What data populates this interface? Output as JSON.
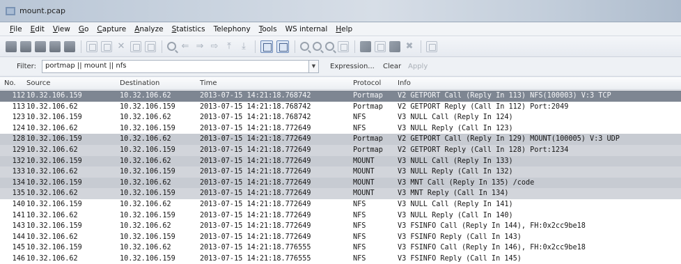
{
  "window": {
    "title": "mount.pcap"
  },
  "menu": [
    {
      "u": "F",
      "rest": "ile"
    },
    {
      "u": "E",
      "rest": "dit"
    },
    {
      "u": "V",
      "rest": "iew"
    },
    {
      "u": "G",
      "rest": "o"
    },
    {
      "u": "C",
      "rest": "apture"
    },
    {
      "u": "A",
      "rest": "nalyze"
    },
    {
      "u": "S",
      "rest": "tatistics"
    },
    {
      "u": "",
      "rest": "Telephony"
    },
    {
      "u": "T",
      "rest": "ools"
    },
    {
      "u": "",
      "rest": "WS internal"
    },
    {
      "u": "H",
      "rest": "elp"
    }
  ],
  "filter": {
    "label": "Filter:",
    "value": "portmap || mount || nfs",
    "expression": "Expression...",
    "clear": "Clear",
    "apply": "Apply"
  },
  "columns": {
    "no": "No.",
    "source": "Source",
    "destination": "Destination",
    "time": "Time",
    "protocol": "Protocol",
    "info": "Info"
  },
  "rows": [
    {
      "no": "112",
      "src": "10.32.106.159",
      "dst": "10.32.106.62",
      "time": "2013-07-15 14:21:18.768742",
      "proto": "Portmap",
      "info": "V2 GETPORT Call (Reply In 113) NFS(100003) V:3 TCP",
      "style": "sel"
    },
    {
      "no": "113",
      "src": "10.32.106.62",
      "dst": "10.32.106.159",
      "time": "2013-07-15 14:21:18.768742",
      "proto": "Portmap",
      "info": "V2 GETPORT Reply (Call In 112) Port:2049",
      "style": ""
    },
    {
      "no": "123",
      "src": "10.32.106.159",
      "dst": "10.32.106.62",
      "time": "2013-07-15 14:21:18.768742",
      "proto": "NFS",
      "info": "V3 NULL Call (Reply In 124)",
      "style": ""
    },
    {
      "no": "124",
      "src": "10.32.106.62",
      "dst": "10.32.106.159",
      "time": "2013-07-15 14:21:18.772649",
      "proto": "NFS",
      "info": "V3 NULL Reply (Call In 123)",
      "style": ""
    },
    {
      "no": "128",
      "src": "10.32.106.159",
      "dst": "10.32.106.62",
      "time": "2013-07-15 14:21:18.772649",
      "proto": "Portmap",
      "info": "V2 GETPORT Call (Reply In 129) MOUNT(100005) V:3 UDP",
      "style": "hl"
    },
    {
      "no": "129",
      "src": "10.32.106.62",
      "dst": "10.32.106.159",
      "time": "2013-07-15 14:21:18.772649",
      "proto": "Portmap",
      "info": "V2 GETPORT Reply (Call In 128) Port:1234",
      "style": "hl alt"
    },
    {
      "no": "132",
      "src": "10.32.106.159",
      "dst": "10.32.106.62",
      "time": "2013-07-15 14:21:18.772649",
      "proto": "MOUNT",
      "info": "V3 NULL Call (Reply In 133)",
      "style": "hl"
    },
    {
      "no": "133",
      "src": "10.32.106.62",
      "dst": "10.32.106.159",
      "time": "2013-07-15 14:21:18.772649",
      "proto": "MOUNT",
      "info": "V3 NULL Reply (Call In 132)",
      "style": "hl alt"
    },
    {
      "no": "134",
      "src": "10.32.106.159",
      "dst": "10.32.106.62",
      "time": "2013-07-15 14:21:18.772649",
      "proto": "MOUNT",
      "info": "V3 MNT Call (Reply In 135) /code",
      "style": "hl"
    },
    {
      "no": "135",
      "src": "10.32.106.62",
      "dst": "10.32.106.159",
      "time": "2013-07-15 14:21:18.772649",
      "proto": "MOUNT",
      "info": "V3 MNT Reply (Call In 134)",
      "style": "hl alt"
    },
    {
      "no": "140",
      "src": "10.32.106.159",
      "dst": "10.32.106.62",
      "time": "2013-07-15 14:21:18.772649",
      "proto": "NFS",
      "info": "V3 NULL Call (Reply In 141)",
      "style": ""
    },
    {
      "no": "141",
      "src": "10.32.106.62",
      "dst": "10.32.106.159",
      "time": "2013-07-15 14:21:18.772649",
      "proto": "NFS",
      "info": "V3 NULL Reply (Call In 140)",
      "style": ""
    },
    {
      "no": "143",
      "src": "10.32.106.159",
      "dst": "10.32.106.62",
      "time": "2013-07-15 14:21:18.772649",
      "proto": "NFS",
      "info": "V3 FSINFO Call (Reply In 144), FH:0x2cc9be18",
      "style": ""
    },
    {
      "no": "144",
      "src": "10.32.106.62",
      "dst": "10.32.106.159",
      "time": "2013-07-15 14:21:18.772649",
      "proto": "NFS",
      "info": "V3 FSINFO Reply (Call In 143)",
      "style": ""
    },
    {
      "no": "145",
      "src": "10.32.106.159",
      "dst": "10.32.106.62",
      "time": "2013-07-15 14:21:18.776555",
      "proto": "NFS",
      "info": "V3 FSINFO Call (Reply In 146), FH:0x2cc9be18",
      "style": ""
    },
    {
      "no": "146",
      "src": "10.32.106.62",
      "dst": "10.32.106.159",
      "time": "2013-07-15 14:21:18.776555",
      "proto": "NFS",
      "info": "V3 FSINFO Reply (Call In 145)",
      "style": ""
    }
  ],
  "colors": {
    "selected_row": "#7e8692",
    "highlight_row": "#c7cbd2",
    "background": "#ffffff"
  }
}
